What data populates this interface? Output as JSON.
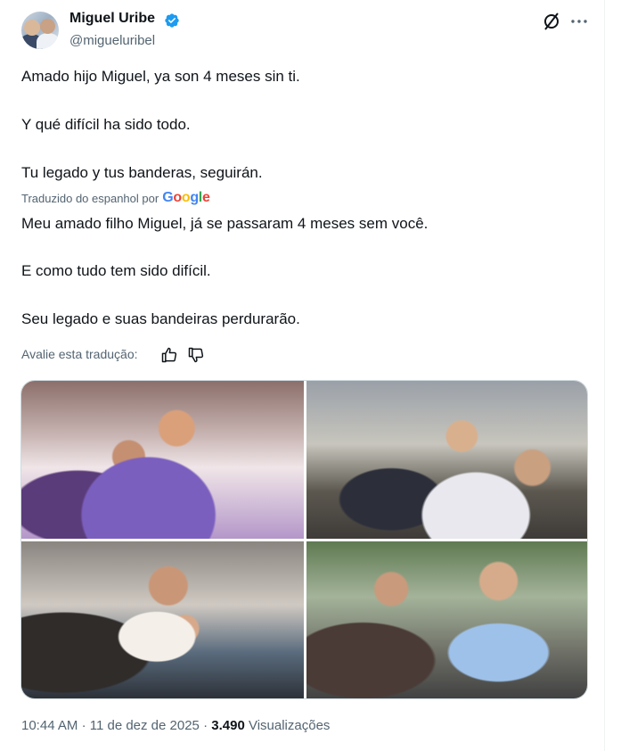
{
  "author": {
    "name": "Miguel Uribe",
    "handle": "@migueluribel",
    "verified": true,
    "avatar_alt": ""
  },
  "tweet": {
    "original_lines": [
      "Amado hijo Miguel, ya son 4 meses sin ti.",
      "Y qué difícil ha sido todo.",
      "Tu legado y tus banderas, seguirán."
    ],
    "translated_label": "Traduzido do espanhol por",
    "translated_provider": "Google",
    "translation_lines": [
      "Meu amado filho Miguel, já se passaram 4 meses sem você.",
      "E como tudo tem sido difícil.",
      "Seu legado e suas bandeiras perdurarão."
    ],
    "rate_prompt": "Avalie esta tradução:",
    "time": "10:44 AM",
    "date": "11 de dez de 2025",
    "views_count": "3.490",
    "views_label": "Visualizações"
  },
  "icons": {
    "verified": "verified-badge-icon",
    "grok": "grok-icon",
    "more": "more-icon",
    "thumb_up": "thumbs-up-icon",
    "thumb_down": "thumbs-down-icon"
  },
  "colors": {
    "verified_blue": "#1d9bf0",
    "text_primary": "#0f1419",
    "text_secondary": "#536471",
    "border": "#cfd9de"
  }
}
